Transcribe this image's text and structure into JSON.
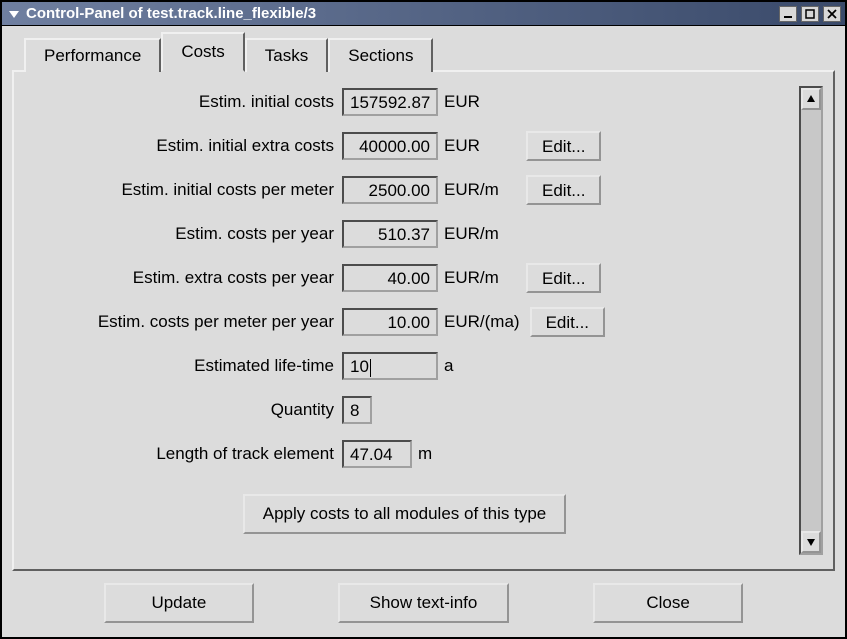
{
  "window": {
    "title": "Control-Panel of test.track.line_flexible/3"
  },
  "tabs": {
    "performance": "Performance",
    "costs": "Costs",
    "tasks": "Tasks",
    "sections": "Sections"
  },
  "labels": {
    "initial_costs": "Estim. initial costs",
    "initial_extra": "Estim. initial extra costs",
    "initial_per_meter": "Estim. initial costs per meter",
    "costs_per_year": "Estim. costs per year",
    "extra_per_year": "Estim. extra costs per year",
    "per_meter_per_year": "Estim. costs per meter per year",
    "lifetime": "Estimated life-time",
    "quantity": "Quantity",
    "length": "Length of track element"
  },
  "values": {
    "initial_costs": "157592.87",
    "initial_extra": "40000.00",
    "initial_per_meter": "2500.00",
    "costs_per_year": "510.37",
    "extra_per_year": "40.00",
    "per_meter_per_year": "10.00",
    "lifetime": "10",
    "quantity": "8",
    "length": "47.04"
  },
  "units": {
    "eur": "EUR",
    "eur_m": "EUR/m",
    "eur_ma": "EUR/(ma)",
    "a": "a",
    "m": "m"
  },
  "buttons": {
    "edit": "Edit...",
    "apply": "Apply costs to all modules of this type",
    "update": "Update",
    "textinfo": "Show text-info",
    "close": "Close"
  }
}
